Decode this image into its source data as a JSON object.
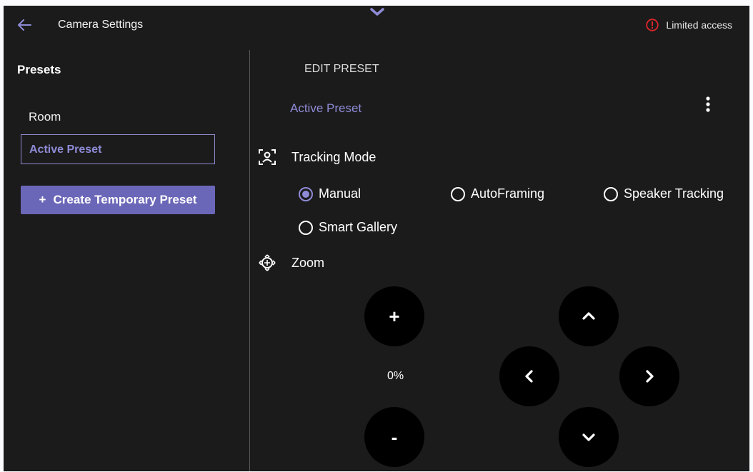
{
  "header": {
    "title": "Camera Settings",
    "back_icon": "arrow-left-icon",
    "drawer_handle_icon": "chevron-down-icon",
    "status_text": "Limited access",
    "status_icon": "alert-circle-icon"
  },
  "sidebar": {
    "heading": "Presets",
    "items": [
      {
        "label": "Room",
        "selected": false
      },
      {
        "label": "Active Preset",
        "selected": true
      }
    ],
    "create_button": {
      "icon": "+",
      "label": "Create Temporary Preset"
    }
  },
  "editor": {
    "heading": "EDIT PRESET",
    "preset_name": "Active Preset",
    "more_icon": "more-vertical-icon",
    "tracking": {
      "label": "Tracking Mode",
      "icon": "face-tracking-icon",
      "options": [
        {
          "label": "Manual",
          "selected": true
        },
        {
          "label": "AutoFraming",
          "selected": false
        },
        {
          "label": "Speaker Tracking",
          "selected": false
        },
        {
          "label": "Smart Gallery",
          "selected": false
        }
      ]
    },
    "zoom": {
      "label": "Zoom",
      "icon": "pan-tilt-icon",
      "plus": "+",
      "minus": "-",
      "value": "0%"
    }
  },
  "colors": {
    "background": "#1b1b1b",
    "accent": "#8e8bd6",
    "button": "#6b67b8",
    "warning": "#e0262b"
  }
}
